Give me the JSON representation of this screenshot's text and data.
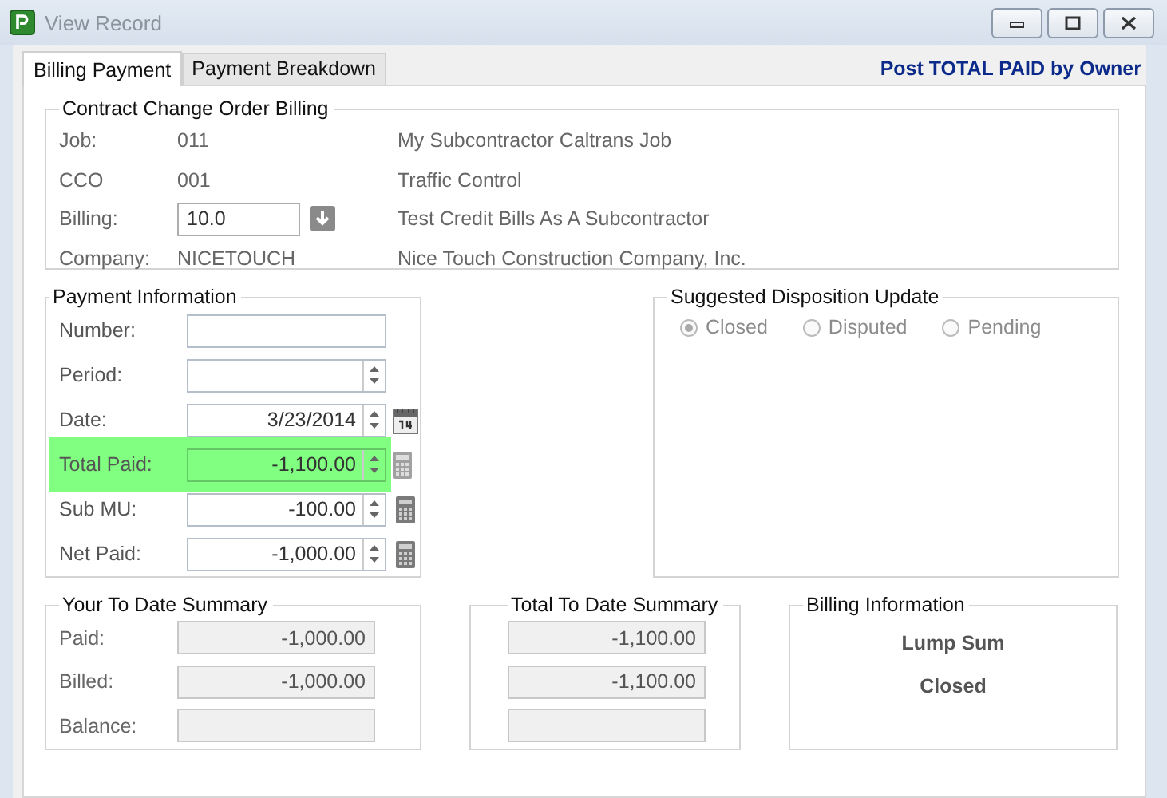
{
  "window": {
    "title": "View Record"
  },
  "tabs": [
    {
      "label": "Billing Payment",
      "selected": true
    },
    {
      "label": "Payment Breakdown",
      "selected": false
    }
  ],
  "header_link": "Post TOTAL PAID by Owner",
  "cco_group": {
    "title": "Contract Change Order Billing",
    "rows": [
      {
        "label": "Job:",
        "kind": "text",
        "code": "011",
        "description": "My Subcontractor Caltrans Job"
      },
      {
        "label": "CCO",
        "kind": "text",
        "code": "001",
        "description": "Traffic Control"
      },
      {
        "label": "Billing:",
        "kind": "input",
        "code": "10.0",
        "description": "Test Credit Bills As A Subcontractor"
      },
      {
        "label": "Company:",
        "kind": "text",
        "code": "NICETOUCH",
        "description": "Nice Touch Construction Company, Inc."
      }
    ]
  },
  "payment_info": {
    "title": "Payment Information",
    "fields": [
      {
        "label": "Number:",
        "kind": "text",
        "highlighted": false
      },
      {
        "label": "Period:",
        "kind": "spinner",
        "highlighted": false
      },
      {
        "label": "Date:",
        "value": "3/23/2014",
        "kind": "date",
        "highlighted": false
      },
      {
        "label": "Total Paid:",
        "value": "-1,100.00",
        "kind": "amount",
        "highlighted": true
      },
      {
        "label": "Sub MU:",
        "value": "-100.00",
        "kind": "amount",
        "highlighted": false
      },
      {
        "label": "Net Paid:",
        "value": "-1,000.00",
        "kind": "amount",
        "highlighted": false
      }
    ]
  },
  "disposition": {
    "title": "Suggested Disposition Update",
    "disabled": true,
    "options": [
      {
        "label": "Closed",
        "selected": true
      },
      {
        "label": "Disputed",
        "selected": false
      },
      {
        "label": "Pending",
        "selected": false
      }
    ]
  },
  "your_summary": {
    "title": "Your To Date Summary",
    "rows": [
      {
        "label": "Paid:",
        "value": "-1,000.00"
      },
      {
        "label": "Billed:",
        "value": "-1,000.00"
      },
      {
        "label": "Balance:"
      }
    ]
  },
  "total_summary": {
    "title": "Total To Date Summary",
    "rows": [
      {
        "value": "-1,100.00"
      },
      {
        "value": "-1,100.00"
      },
      {}
    ]
  },
  "billing_info": {
    "title": "Billing Information",
    "lines": [
      "Lump Sum",
      "Closed"
    ]
  }
}
